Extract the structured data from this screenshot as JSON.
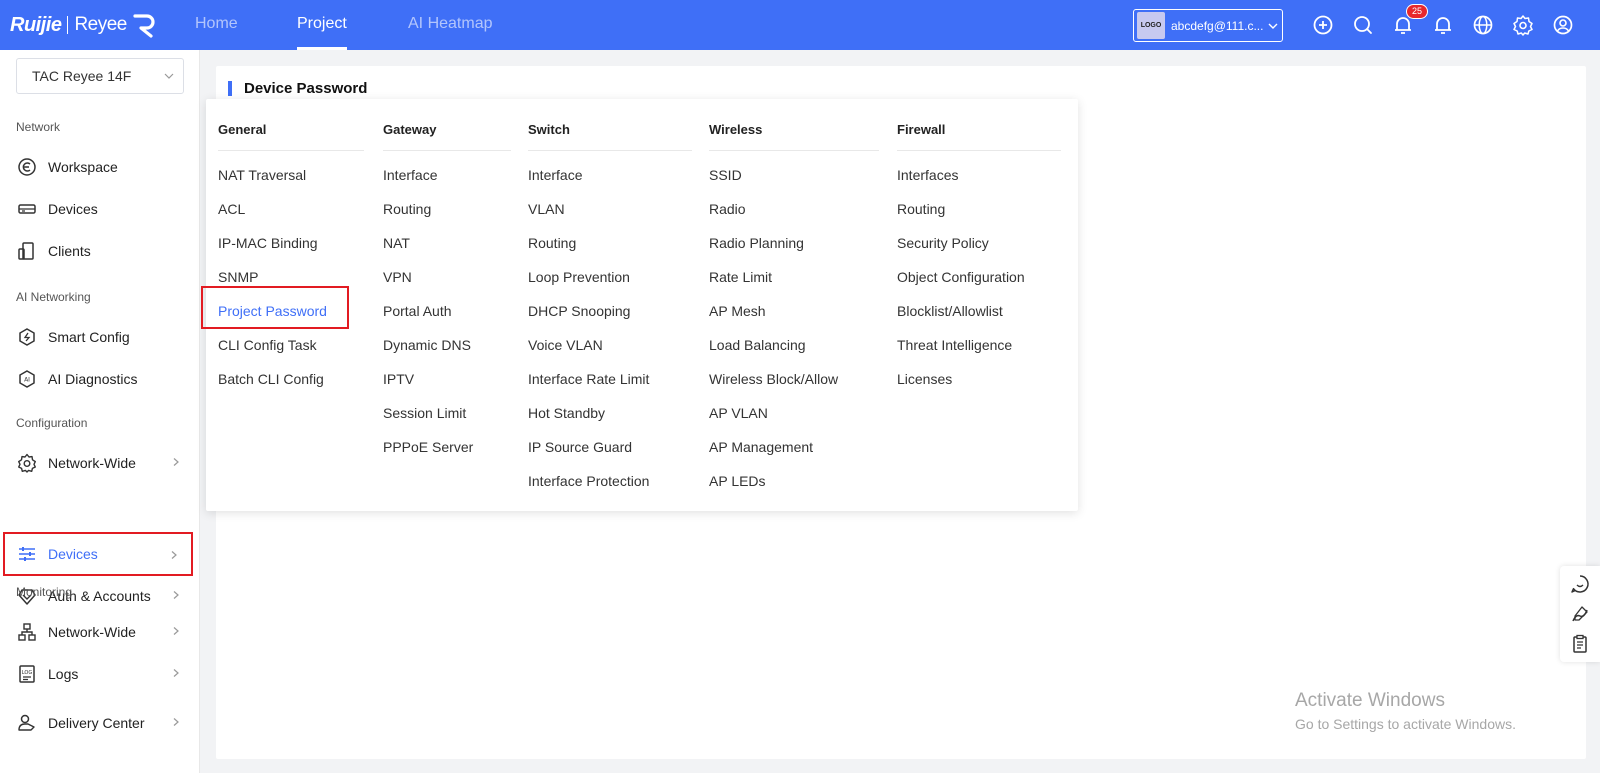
{
  "brand": {
    "name": "Ruijie",
    "sub": "Reyee"
  },
  "nav": {
    "tabs": [
      "Home",
      "Project",
      "AI Heatmap"
    ],
    "active": "Project"
  },
  "account": {
    "logo_text": "LOGO",
    "email": "abcdefg@111.c..."
  },
  "notifications": {
    "count": "25"
  },
  "sidebar": {
    "project": "TAC  Reyee  14F",
    "sections": {
      "network": "Network",
      "ai": "AI Networking",
      "config": "Configuration",
      "monitoring": "Monitoring"
    },
    "items": {
      "workspace": "Workspace",
      "devices": "Devices",
      "clients": "Clients",
      "smart_config": "Smart Config",
      "ai_diagnostics": "AI Diagnostics",
      "network_wide": "Network-Wide",
      "config_devices": "Devices",
      "auth_accounts": "Auth & Accounts",
      "mon_network_wide": "Network-Wide",
      "logs": "Logs",
      "delivery_center": "Delivery Center"
    }
  },
  "page": {
    "title": "Device Password"
  },
  "menu": {
    "general": {
      "title": "General",
      "items": [
        "NAT Traversal",
        "ACL",
        "IP-MAC Binding",
        "SNMP",
        "Project Password",
        "CLI Config Task",
        "Batch CLI Config"
      ]
    },
    "gateway": {
      "title": "Gateway",
      "items": [
        "Interface",
        "Routing",
        "NAT",
        "VPN",
        "Portal Auth",
        "Dynamic DNS",
        "IPTV",
        "Session Limit",
        "PPPoE Server"
      ]
    },
    "switch": {
      "title": "Switch",
      "items": [
        "Interface",
        "VLAN",
        "Routing",
        "Loop Prevention",
        "DHCP Snooping",
        "Voice VLAN",
        "Interface Rate Limit",
        "Hot Standby",
        "IP Source Guard",
        "Interface Protection"
      ]
    },
    "wireless": {
      "title": "Wireless",
      "items": [
        "SSID",
        "Radio",
        "Radio Planning",
        "Rate Limit",
        "AP Mesh",
        "Load Balancing",
        "Wireless Block/Allow",
        "AP VLAN",
        "AP Management",
        "AP LEDs"
      ]
    },
    "firewall": {
      "title": "Firewall",
      "items": [
        "Interfaces",
        "Routing",
        "Security Policy",
        "Object Configuration",
        "Blocklist/Allowlist",
        "Threat Intelligence",
        "Licenses"
      ]
    }
  },
  "watermark": {
    "line1": "Activate Windows",
    "line2": "Go to Settings to activate Windows."
  },
  "colors": {
    "accent": "#3f6ff7",
    "highlight": "#e21b22"
  }
}
